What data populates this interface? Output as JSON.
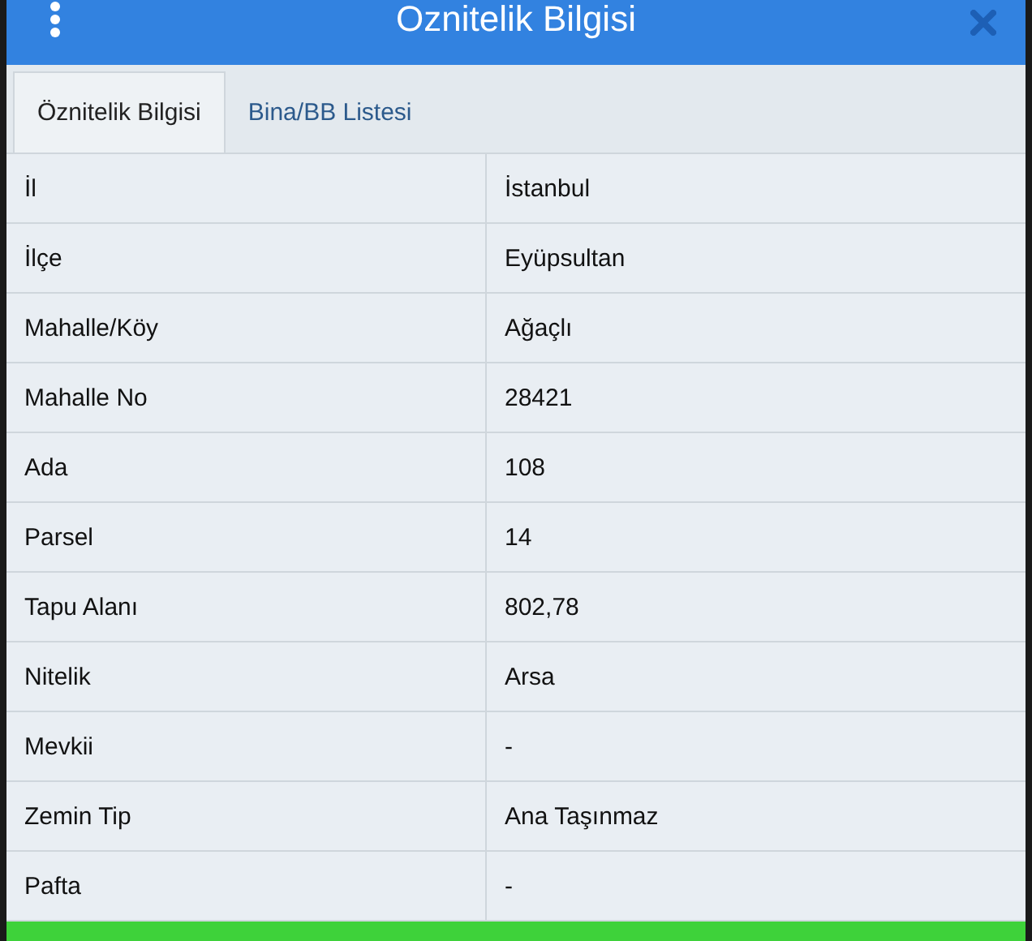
{
  "window": {
    "title": "Oznitelik Bilgisi"
  },
  "tabs": [
    {
      "label": "Öznitelik Bilgisi",
      "selected": true
    },
    {
      "label": "Bina/BB Listesi",
      "selected": false
    }
  ],
  "table": {
    "rows": [
      {
        "label": "İl",
        "value": "İstanbul"
      },
      {
        "label": "İlçe",
        "value": "Eyüpsultan"
      },
      {
        "label": "Mahalle/Köy",
        "value": "Ağaçlı"
      },
      {
        "label": "Mahalle No",
        "value": "28421"
      },
      {
        "label": "Ada",
        "value": "108"
      },
      {
        "label": "Parsel",
        "value": "14"
      },
      {
        "label": "Tapu Alanı",
        "value": "802,78"
      },
      {
        "label": "Nitelik",
        "value": "Arsa"
      },
      {
        "label": "Mevkii",
        "value": "-"
      },
      {
        "label": "Zemin Tip",
        "value": "Ana Taşınmaz"
      },
      {
        "label": "Pafta",
        "value": "-"
      }
    ]
  }
}
